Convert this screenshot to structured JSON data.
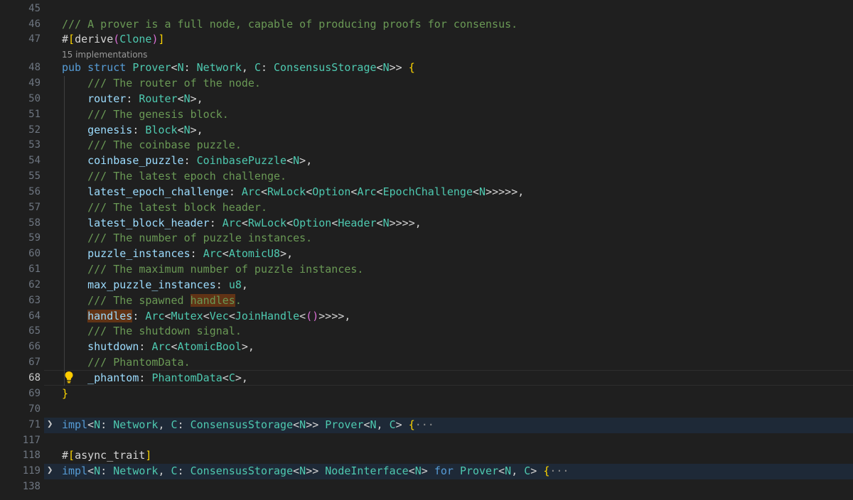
{
  "editor": {
    "codelens": "15 implementations",
    "active_line": "68",
    "lines": [
      {
        "n": "45",
        "t": ""
      },
      {
        "n": "46",
        "t": "/// A prover is a full node, capable of producing proofs for consensus."
      },
      {
        "n": "47",
        "t": "#[derive(Clone)]"
      },
      {
        "n": "48",
        "t": "pub struct Prover<N: Network, C: ConsensusStorage<N>> {"
      },
      {
        "n": "49",
        "t": "    /// The router of the node."
      },
      {
        "n": "50",
        "t": "    router: Router<N>,"
      },
      {
        "n": "51",
        "t": "    /// The genesis block."
      },
      {
        "n": "52",
        "t": "    genesis: Block<N>,"
      },
      {
        "n": "53",
        "t": "    /// The coinbase puzzle."
      },
      {
        "n": "54",
        "t": "    coinbase_puzzle: CoinbasePuzzle<N>,"
      },
      {
        "n": "55",
        "t": "    /// The latest epoch challenge."
      },
      {
        "n": "56",
        "t": "    latest_epoch_challenge: Arc<RwLock<Option<Arc<EpochChallenge<N>>>>>,"
      },
      {
        "n": "57",
        "t": "    /// The latest block header."
      },
      {
        "n": "58",
        "t": "    latest_block_header: Arc<RwLock<Option<Header<N>>>>,"
      },
      {
        "n": "59",
        "t": "    /// The number of puzzle instances."
      },
      {
        "n": "60",
        "t": "    puzzle_instances: Arc<AtomicU8>,"
      },
      {
        "n": "61",
        "t": "    /// The maximum number of puzzle instances."
      },
      {
        "n": "62",
        "t": "    max_puzzle_instances: u8,"
      },
      {
        "n": "63",
        "t": "    /// The spawned handles."
      },
      {
        "n": "64",
        "t": "    handles: Arc<Mutex<Vec<JoinHandle<()>>>>,"
      },
      {
        "n": "65",
        "t": "    /// The shutdown signal."
      },
      {
        "n": "66",
        "t": "    shutdown: Arc<AtomicBool>,"
      },
      {
        "n": "67",
        "t": "    /// PhantomData."
      },
      {
        "n": "68",
        "t": "    _phantom: PhantomData<C>,"
      },
      {
        "n": "69",
        "t": "}"
      },
      {
        "n": "70",
        "t": ""
      },
      {
        "n": "71",
        "t": "impl<N: Network, C: ConsensusStorage<N>> Prover<N, C> {···"
      },
      {
        "n": "117",
        "t": ""
      },
      {
        "n": "118",
        "t": "#[async_trait]"
      },
      {
        "n": "119",
        "t": "impl<N: Network, C: ConsensusStorage<N>> NodeInterface<N> for Prover<N, C> {···"
      },
      {
        "n": "138",
        "t": ""
      }
    ]
  },
  "icons": {
    "fold": "chevron-right-icon",
    "lightbulb": "lightbulb-icon"
  },
  "colors": {
    "background": "#1f1f1f",
    "comment": "#6a9955",
    "keyword": "#569cd6",
    "type": "#4ec9b0",
    "field": "#9cdcfe",
    "bracket": "#ffd700",
    "highlight": "#613315",
    "folded_row": "#1e2937"
  }
}
